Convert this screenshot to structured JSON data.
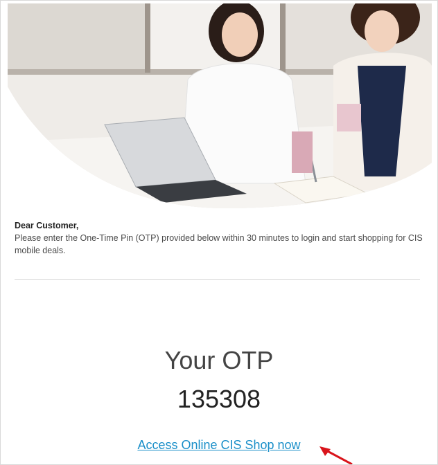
{
  "email": {
    "hero_image": "two-women-working-laptop-photo",
    "greeting": "Dear Customer,",
    "body_text": "Please enter the One-Time Pin (OTP) provided below within 30 minutes to login and start shopping for CIS mobile deals.",
    "otp_title": "Your OTP",
    "otp_code": "135308",
    "shop_link_label": "Access Online CIS Shop now"
  },
  "annotation": {
    "arrow_icon": "red-arrow-icon",
    "arrow_color": "#d9141b"
  },
  "colors": {
    "link": "#1a8fc9",
    "text": "#4a4a4a",
    "heading": "#222222"
  }
}
